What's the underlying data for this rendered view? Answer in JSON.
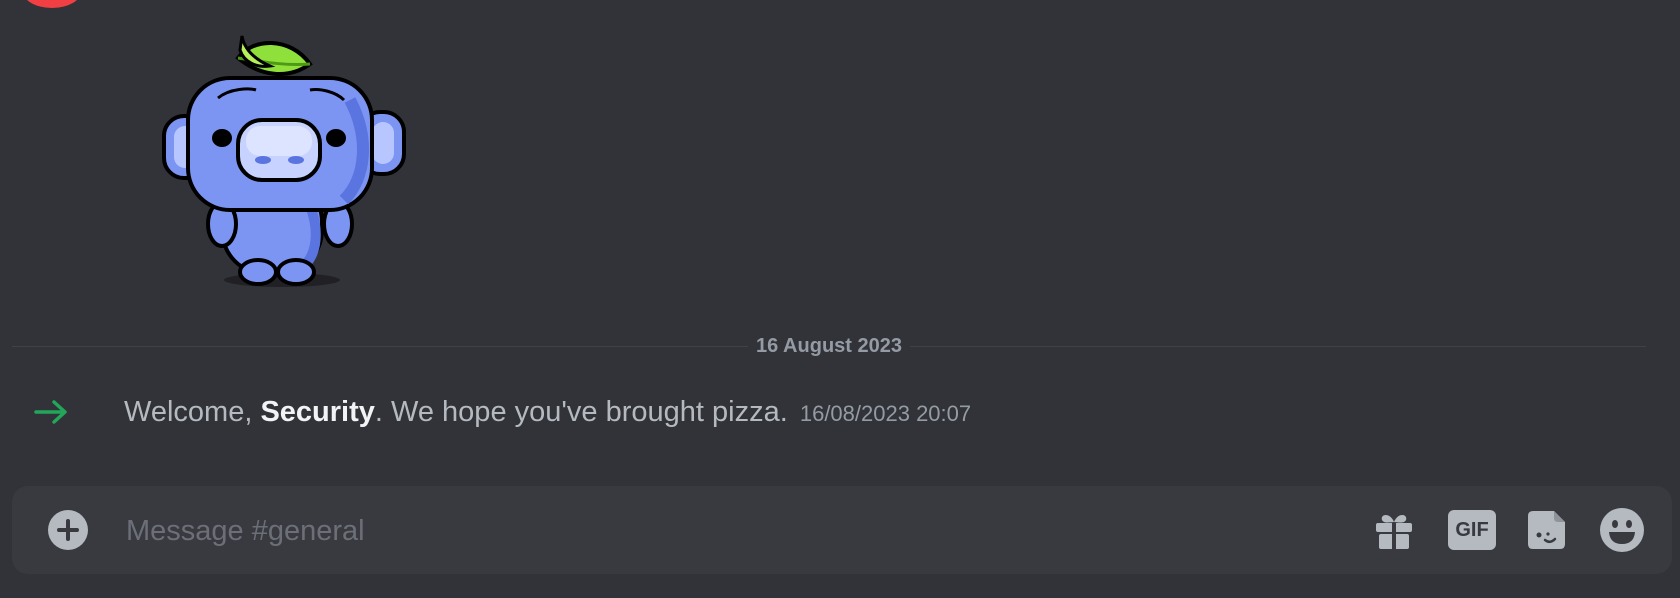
{
  "divider": {
    "date": "16 August 2023"
  },
  "system_message": {
    "prefix": "Welcome, ",
    "username": "Security",
    "suffix": ". We hope you've brought pizza.",
    "timestamp": "16/08/2023 20:07",
    "icon": "join-arrow-icon",
    "icon_color": "#23a55a"
  },
  "sticker": {
    "name": "wumpus-sticker"
  },
  "composer": {
    "placeholder": "Message #general",
    "attach_icon": "plus-circle-icon",
    "gift_icon": "gift-icon",
    "gif_label": "GIF",
    "sticker_icon": "sticker-icon",
    "emoji_icon": "emoji-icon"
  },
  "colors": {
    "background": "#313338",
    "composer_bg": "#383a40",
    "muted_text": "#949ba4",
    "body_text": "#b5bac1",
    "username": "#f2f3f5",
    "accent_green": "#23a55a",
    "avatar_red": "#f23f43"
  }
}
